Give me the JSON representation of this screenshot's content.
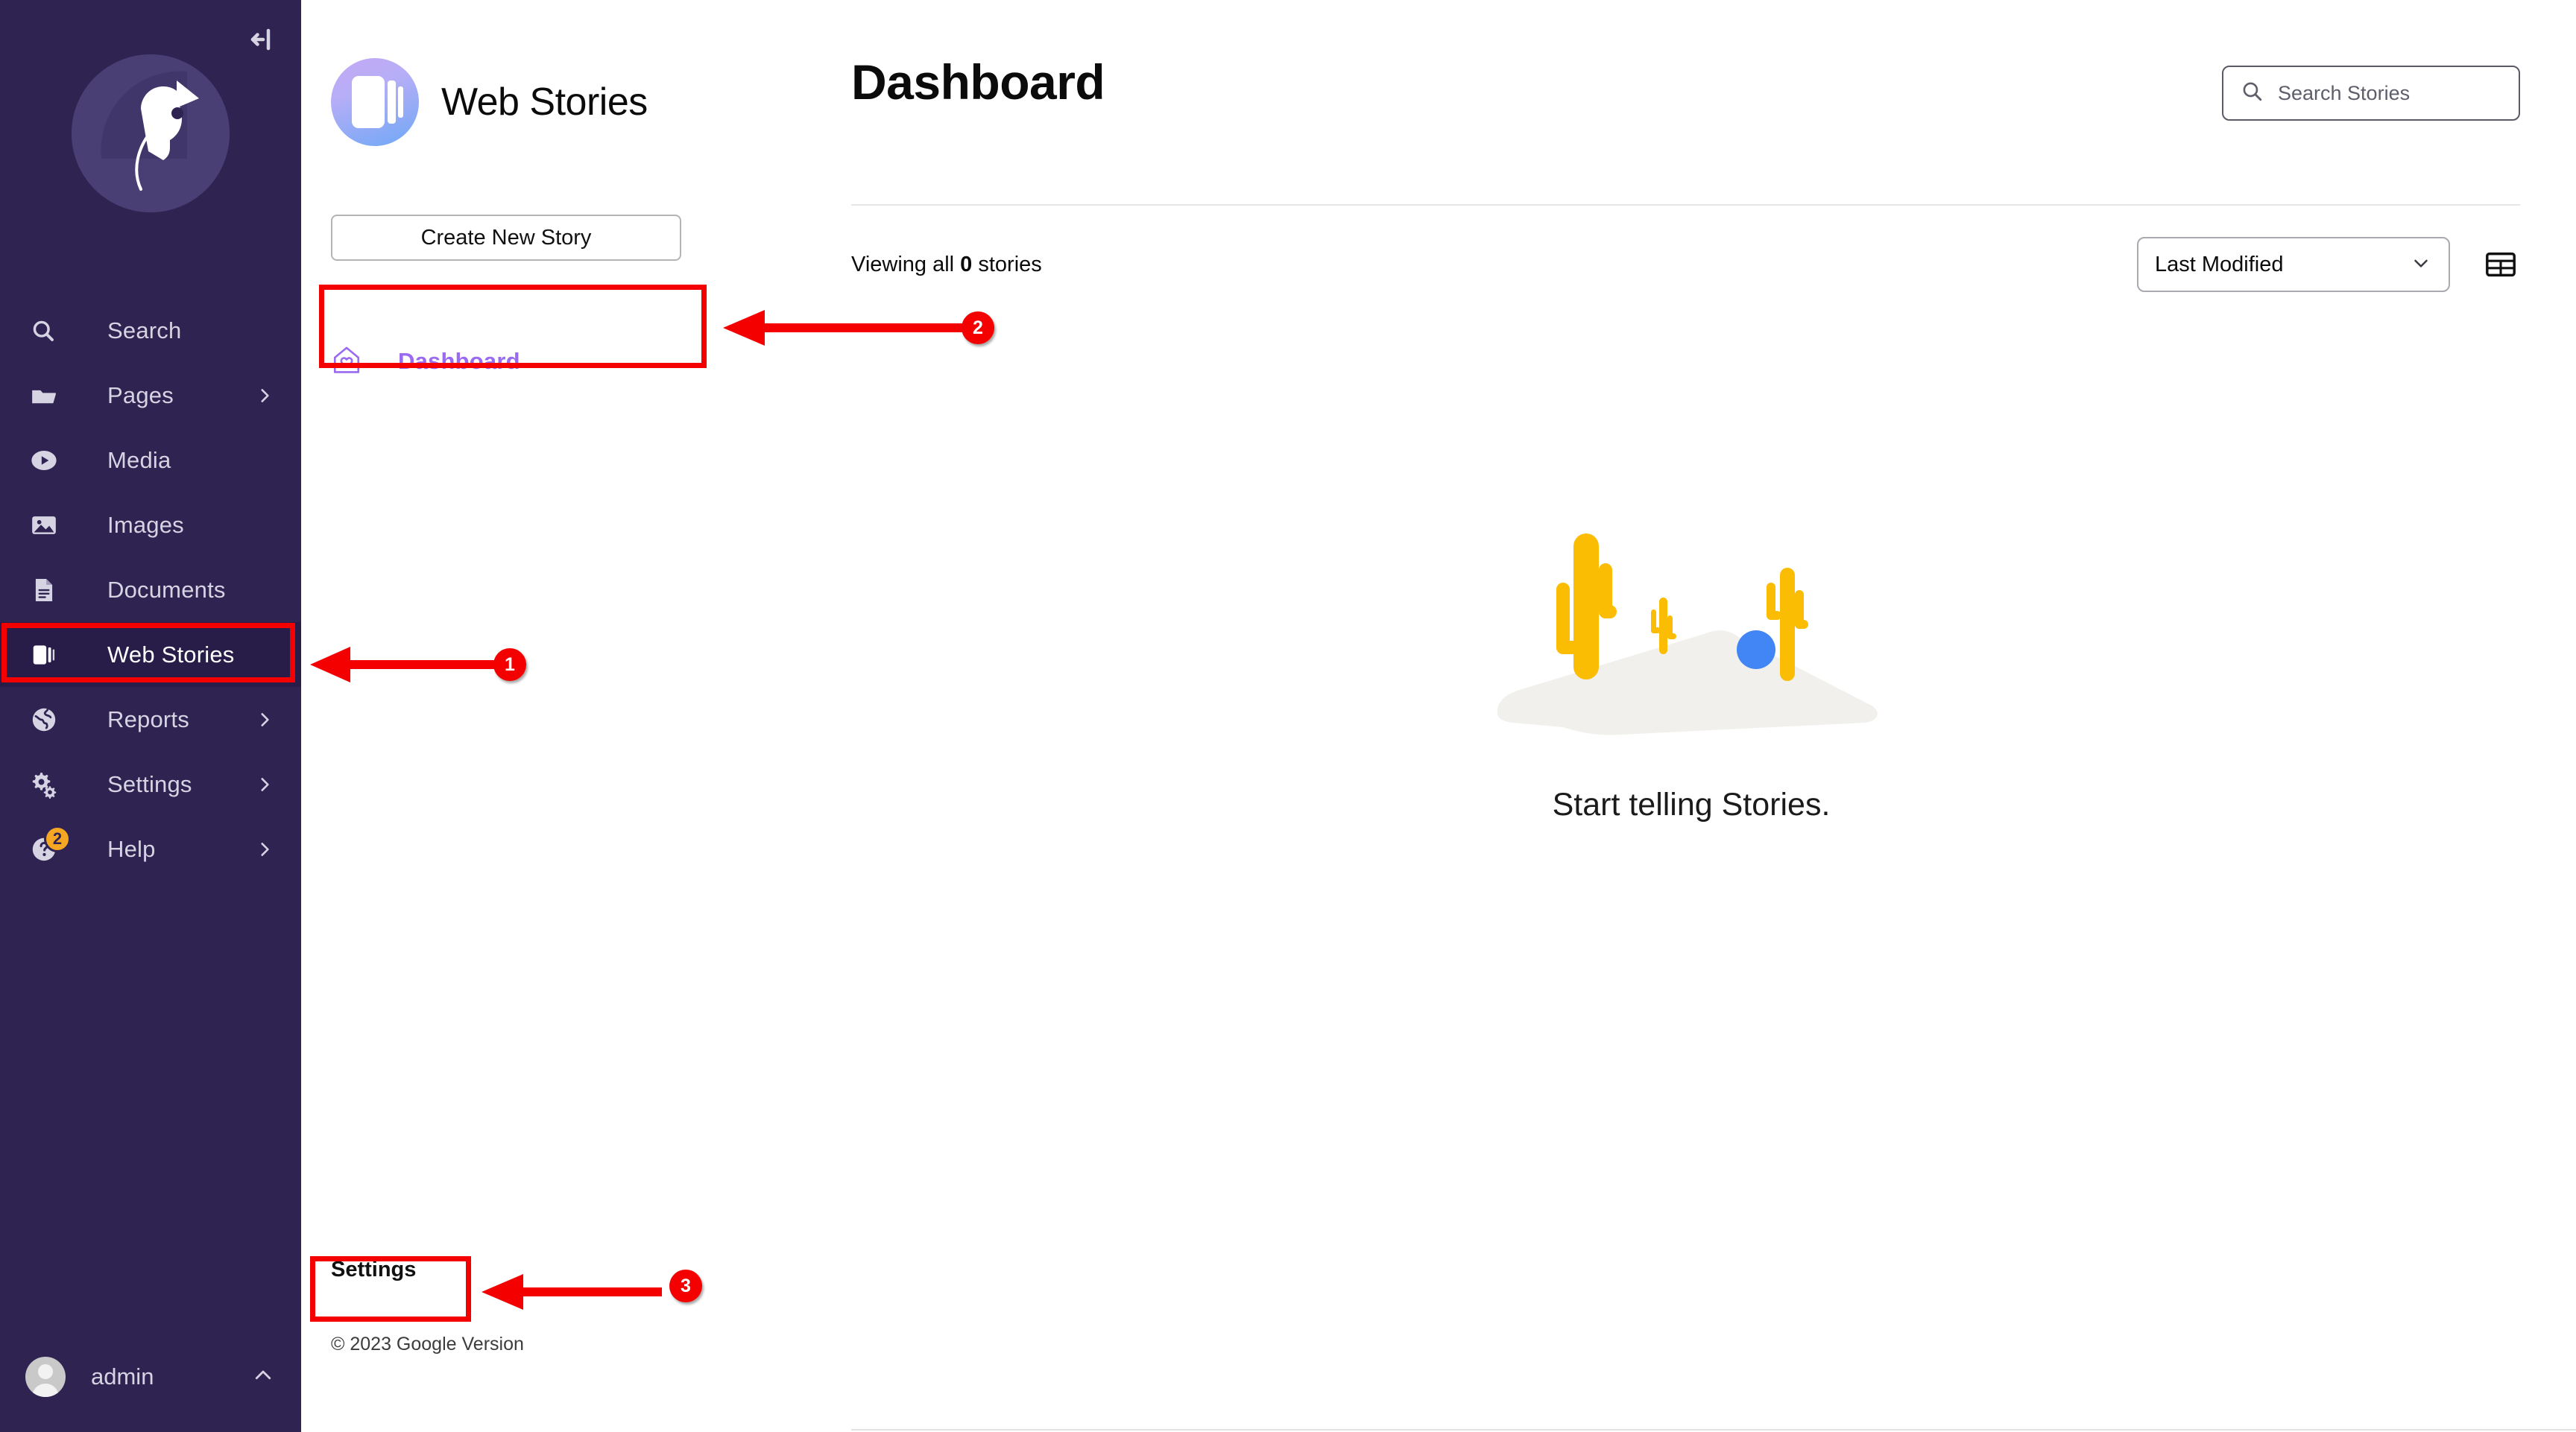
{
  "sidebar": {
    "collapse_icon": "collapse-left-icon",
    "logo_icon": "bird-logo-icon",
    "items": [
      {
        "label": "Search",
        "icon": "search-icon",
        "chevron": false,
        "active": false,
        "badge": null
      },
      {
        "label": "Pages",
        "icon": "folder-icon",
        "chevron": true,
        "active": false,
        "badge": null
      },
      {
        "label": "Media",
        "icon": "play-circle-icon",
        "chevron": false,
        "active": false,
        "badge": null
      },
      {
        "label": "Images",
        "icon": "image-icon",
        "chevron": false,
        "active": false,
        "badge": null
      },
      {
        "label": "Documents",
        "icon": "document-icon",
        "chevron": false,
        "active": false,
        "badge": null
      },
      {
        "label": "Web Stories",
        "icon": "web-stories-icon",
        "chevron": false,
        "active": true,
        "badge": null
      },
      {
        "label": "Reports",
        "icon": "globe-icon",
        "chevron": true,
        "active": false,
        "badge": null
      },
      {
        "label": "Settings",
        "icon": "gears-icon",
        "chevron": true,
        "active": false,
        "badge": null
      },
      {
        "label": "Help",
        "icon": "question-circle-icon",
        "chevron": true,
        "active": false,
        "badge": "2"
      }
    ],
    "user": {
      "name": "admin",
      "avatar_icon": "avatar-icon",
      "caret_icon": "chevron-up-icon"
    },
    "colors": {
      "background": "#2f2352",
      "active_background": "#281d49",
      "text": "#d6d3e3",
      "badge": "#f5a623"
    }
  },
  "plugin": {
    "brand": {
      "title": "Web Stories",
      "logo_icon": "web-stories-logo-icon"
    },
    "create_button": {
      "label": "Create New Story"
    },
    "nav": [
      {
        "label": "Dashboard",
        "icon": "home-heart-icon",
        "active": true
      }
    ],
    "settings_link": {
      "label": "Settings"
    },
    "copyright": "© 2023 Google Version",
    "accent_color": "#9a6af0"
  },
  "main": {
    "page_title": "Dashboard",
    "search": {
      "placeholder": "Search Stories",
      "value": "",
      "icon": "search-icon"
    },
    "toolbar": {
      "viewing_prefix": "Viewing all ",
      "viewing_count": "0",
      "viewing_suffix": " stories",
      "sort": {
        "value": "Last Modified",
        "chevron_icon": "chevron-down-icon"
      },
      "view_toggle_icon": "list-view-icon"
    },
    "empty_state": {
      "illustration": "desert-cactus-illustration",
      "message": "Start telling Stories.",
      "colors": {
        "cactus": "#fbbc04",
        "ground": "#f1f0ec",
        "ball": "#4285f4"
      }
    }
  },
  "annotations": {
    "color": "#f50000",
    "items": [
      {
        "number": "1",
        "target": "sidebar-item-web-stories"
      },
      {
        "number": "2",
        "target": "create-new-story-button"
      },
      {
        "number": "3",
        "target": "plugin-settings-link"
      }
    ]
  }
}
